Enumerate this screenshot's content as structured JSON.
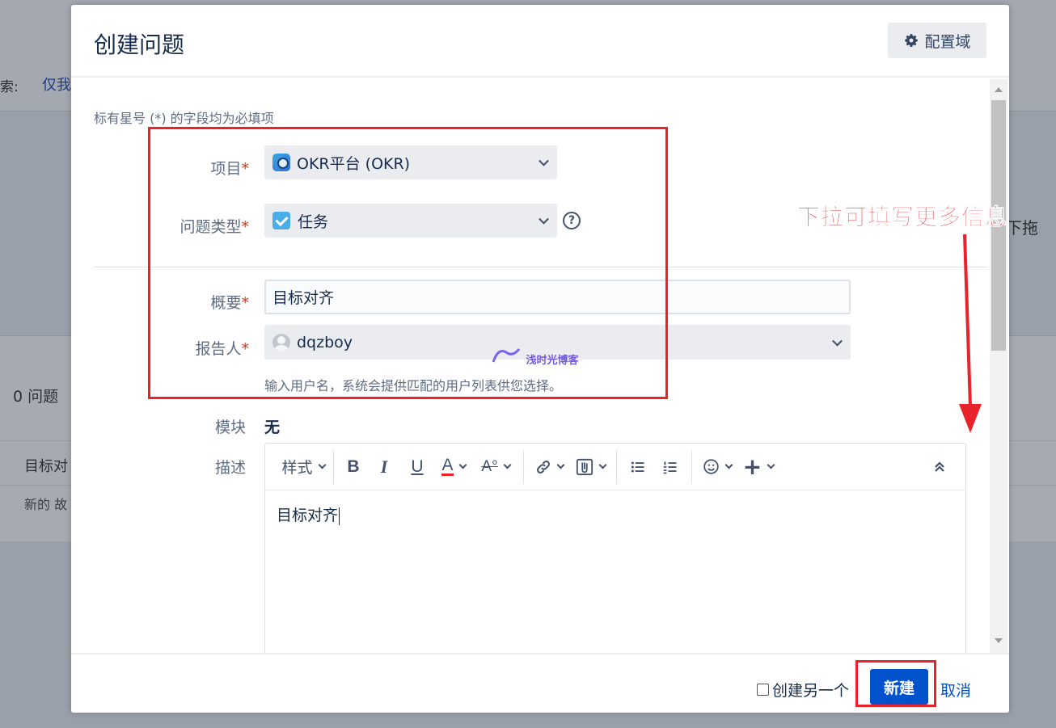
{
  "background": {
    "search_label": "索:",
    "search_link": "仅我",
    "issue_count": "0 问题",
    "issue_title": "目标对",
    "new_story": "新的 故",
    "drag_hint": "下拖"
  },
  "dialog": {
    "title": "创建问题",
    "config_button": "配置域",
    "required_note": "标有星号 (*) 的字段均为必填项",
    "fields": {
      "project": {
        "label": "项目",
        "value": "OKR平台 (OKR)"
      },
      "issue_type": {
        "label": "问题类型",
        "value": "任务"
      },
      "summary": {
        "label": "概要",
        "value": "目标对齐"
      },
      "reporter": {
        "label": "报告人",
        "value": "dqzboy",
        "hint": "输入用户名，系统会提供匹配的用户列表供您选择。"
      },
      "module": {
        "label": "模块",
        "value": "无"
      },
      "description": {
        "label": "描述",
        "content": "目标对齐"
      }
    },
    "required_mark": "*",
    "toolbar": {
      "style": "样式"
    },
    "footer": {
      "create_another": "创建另一个",
      "create_button": "新建",
      "cancel_link": "取消"
    }
  },
  "annotation": {
    "text": "下拉可填写更多信息",
    "color": "#e8232a"
  },
  "watermark": "浅时光博客",
  "colors": {
    "primary": "#0052cc",
    "required": "#de350b",
    "label": "#5e6c84"
  }
}
